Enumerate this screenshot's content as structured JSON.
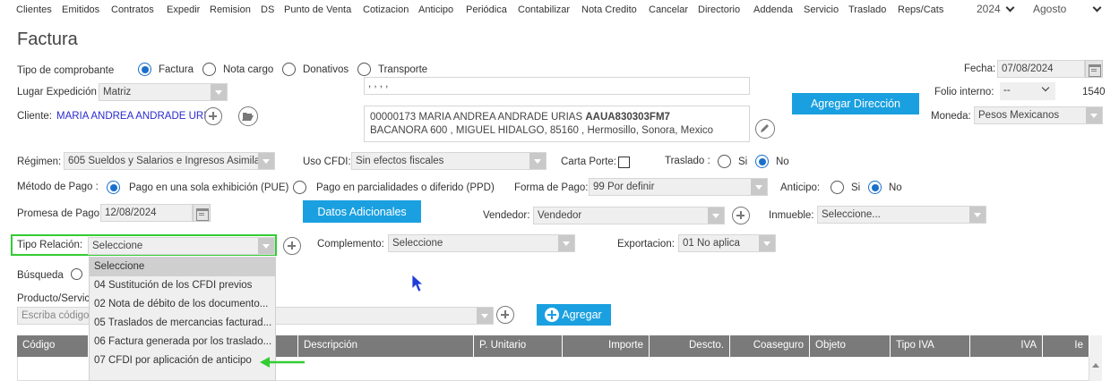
{
  "menu": {
    "items": [
      "Clientes",
      "Emitidos",
      "Contratos",
      "Expedir",
      "Remision",
      "DS",
      "Punto de Venta",
      "Cotizacion",
      "Anticipo",
      "Periódica",
      "Contabilizar",
      "Nota Credito",
      "Cancelar",
      "Directorio",
      "Addenda",
      "Servicio",
      "Traslado",
      "Reps/Cats"
    ],
    "year": "2024",
    "month": "Agosto"
  },
  "page_title": "Factura",
  "tipo_comprobante": {
    "label": "Tipo de comprobante",
    "options": [
      "Factura",
      "Nota cargo",
      "Donativos",
      "Transporte"
    ],
    "selected": "Factura"
  },
  "lugar_expedicion": {
    "label": "Lugar Expedición",
    "value": "Matriz"
  },
  "address_line": ", , , ,",
  "cliente": {
    "label": "Cliente:",
    "value": "MARIA ANDREA ANDRADE URI",
    "detail_line1_prefix": "00000173 MARIA ANDREA ANDRADE URIAS ",
    "detail_rfc": "AAUA830303FM7",
    "detail_line2": "BACANORA 600 , MIGUEL HIDALGO, 85160 , Hermosillo, Sonora, Mexico"
  },
  "agregar_direccion": "Agregar Dirección",
  "fecha": {
    "label": "Fecha:",
    "value": "07/08/2024"
  },
  "folio": {
    "label": "Folio interno:",
    "value": "--",
    "number": "1540"
  },
  "moneda": {
    "label": "Moneda:",
    "value": "Pesos Mexicanos"
  },
  "regimen": {
    "label": "Régimen:",
    "value": "605 Sueldos y Salarios e Ingresos Asimila"
  },
  "uso_cfdi": {
    "label": "Uso CFDI:",
    "value": "Sin efectos fiscales"
  },
  "carta_porte": {
    "label": "Carta Porte:"
  },
  "traslado": {
    "label": "Traslado :",
    "si": "Si",
    "no": "No",
    "selected": "No"
  },
  "metodo_pago": {
    "label": "Método de Pago :",
    "pue": "Pago en una sola exhibición (PUE)",
    "ppd": "Pago en parcialidades o diferido (PPD)",
    "selected": "PUE"
  },
  "forma_pago": {
    "label": "Forma de Pago:",
    "value": "99  Por definir"
  },
  "anticipo": {
    "label": "Anticipo:",
    "si": "Si",
    "no": "No",
    "selected": "No"
  },
  "promesa_pago": {
    "label": "Promesa de Pago",
    "value": "12/08/2024"
  },
  "datos_adicionales": "Datos Adicionales",
  "vendedor": {
    "label": "Vendedor:",
    "value": "Vendedor"
  },
  "inmueble": {
    "label": "Inmueble:",
    "value": "Seleccione..."
  },
  "tipo_relacion": {
    "label": "Tipo Relación:",
    "value": "Seleccione",
    "options": [
      "Seleccione",
      "04 Sustitución de los CFDI previos",
      "02 Nota de débito de los documento...",
      "05 Traslados de mercancias facturad...",
      "06 Factura generada por los traslado...",
      "07 CFDI por aplicación de anticipo"
    ]
  },
  "complemento": {
    "label": "Complemento:",
    "value": "Seleccione"
  },
  "exportacion": {
    "label": "Exportacion:",
    "value": "01 No aplica"
  },
  "busqueda": {
    "label": "Búsqueda"
  },
  "producto": {
    "label": "Producto/Servic",
    "placeholder": "Escriba código"
  },
  "agregar": "Agregar",
  "table": {
    "headers": [
      "Código",
      "",
      "Descripción",
      "P. Unitario",
      "Importe",
      "Descto.",
      "Coaseguro",
      "Objeto",
      "Tipo IVA",
      "IVA",
      "Ie"
    ]
  },
  "colors": {
    "accent": "#1aa0e0",
    "highlight_border": "#33cc33",
    "arrow": "#33cc33",
    "cursor": "#1e3cd8"
  }
}
